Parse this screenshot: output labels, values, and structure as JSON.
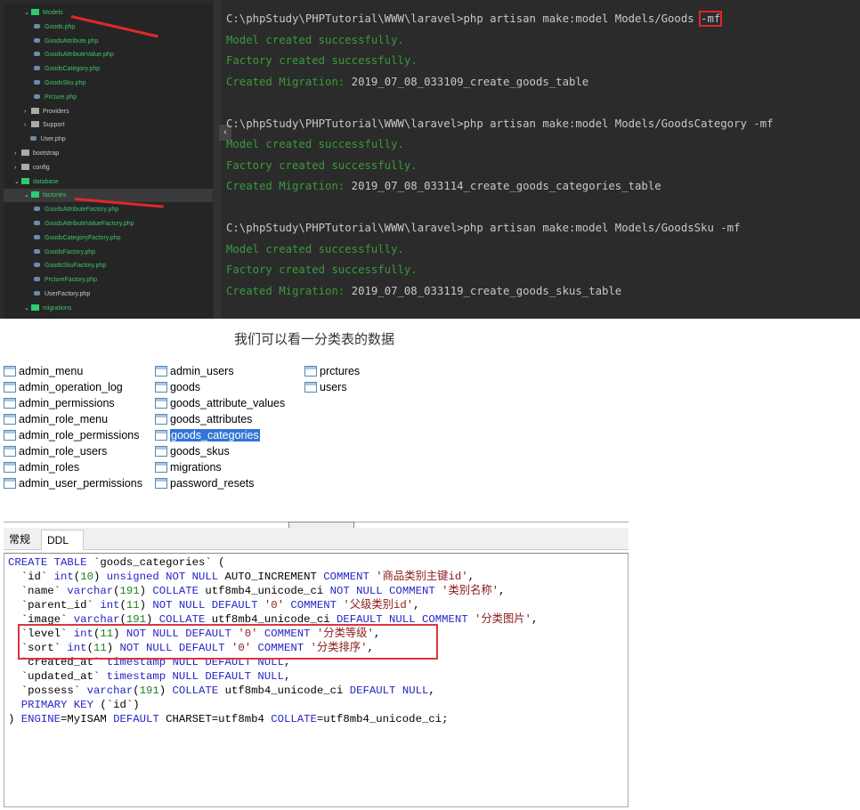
{
  "tree": [
    {
      "label": "Models",
      "kind": "folder",
      "open": true,
      "indent": 1,
      "green": true
    },
    {
      "label": "Goods.php",
      "kind": "php",
      "indent": 2,
      "green": true
    },
    {
      "label": "GoodsAttribute.php",
      "kind": "php",
      "indent": 2,
      "green": true
    },
    {
      "label": "GoodsAttributeValue.php",
      "kind": "php",
      "indent": 2,
      "green": true
    },
    {
      "label": "GoodsCategory.php",
      "kind": "php",
      "indent": 2,
      "green": true
    },
    {
      "label": "GoodsSku.php",
      "kind": "php",
      "indent": 2,
      "green": true
    },
    {
      "label": "Prcture.php",
      "kind": "php",
      "indent": 2,
      "green": true
    },
    {
      "label": "Providers",
      "kind": "folder",
      "open": false,
      "indent": 1
    },
    {
      "label": "Support",
      "kind": "folder",
      "open": false,
      "indent": 1
    },
    {
      "label": "User.php",
      "kind": "php",
      "indent": 1.6
    },
    {
      "label": "bootstrap",
      "kind": "folder",
      "open": false,
      "indent": 0
    },
    {
      "label": "config",
      "kind": "folder",
      "open": false,
      "indent": 0
    },
    {
      "label": "database",
      "kind": "folder",
      "open": true,
      "indent": 0,
      "green": true
    },
    {
      "label": "factories",
      "kind": "folder",
      "open": true,
      "indent": 1,
      "green": true,
      "selected": true
    },
    {
      "label": "GoodsAttributeFactory.php",
      "kind": "php",
      "indent": 2,
      "green": true
    },
    {
      "label": "GoodsAttributeValueFactory.php",
      "kind": "php",
      "indent": 2,
      "green": true
    },
    {
      "label": "GoodsCategoryFactory.php",
      "kind": "php",
      "indent": 2,
      "green": true
    },
    {
      "label": "GoodsFactory.php",
      "kind": "php",
      "indent": 2,
      "green": true
    },
    {
      "label": "GoodsSkuFactory.php",
      "kind": "php",
      "indent": 2,
      "green": true
    },
    {
      "label": "PrctureFactory.php",
      "kind": "php",
      "indent": 2,
      "green": true
    },
    {
      "label": "UserFactory.php",
      "kind": "php",
      "indent": 2
    },
    {
      "label": "migrations",
      "kind": "folder",
      "open": true,
      "indent": 1,
      "green": true
    }
  ],
  "terminal": [
    {
      "type": "cmd",
      "text": "C:\\phpStudy\\PHPTutorial\\WWW\\laravel>php artisan make:model Models/Goods ",
      "flag": "-mf",
      "highlight": true
    },
    {
      "type": "ok",
      "text": "Model created successfully."
    },
    {
      "type": "ok",
      "text": "Factory created successfully."
    },
    {
      "type": "mig",
      "text": "Created Migration: ",
      "name": "2019_07_08_033109_create_goods_table"
    },
    {
      "type": "blank",
      "text": ""
    },
    {
      "type": "cmd",
      "text": "C:\\phpStudy\\PHPTutorial\\WWW\\laravel>php artisan make:model Models/GoodsCategory ",
      "flag": "-mf"
    },
    {
      "type": "ok",
      "text": "Model created successfully."
    },
    {
      "type": "ok",
      "text": "Factory created successfully."
    },
    {
      "type": "mig",
      "text": "Created Migration: ",
      "name": "2019_07_08_033114_create_goods_categories_table"
    },
    {
      "type": "blank",
      "text": ""
    },
    {
      "type": "cmd",
      "text": "C:\\phpStudy\\PHPTutorial\\WWW\\laravel>php artisan make:model Models/GoodsSku ",
      "flag": "-mf"
    },
    {
      "type": "ok",
      "text": "Model created successfully."
    },
    {
      "type": "ok",
      "text": "Factory created successfully."
    },
    {
      "type": "mig",
      "text": "Created Migration: ",
      "name": "2019_07_08_033119_create_goods_skus_table"
    }
  ],
  "caption": "我们可以看一分类表的数据",
  "tables": [
    [
      "admin_menu",
      "admin_operation_log",
      "admin_permissions",
      "admin_role_menu",
      "admin_role_permissions",
      "admin_role_users",
      "admin_roles",
      "admin_user_permissions"
    ],
    [
      "admin_users",
      "goods",
      "goods_attribute_values",
      "goods_attributes",
      "goods_categories",
      "goods_skus",
      "migrations",
      "password_resets"
    ],
    [
      "prctures",
      "users"
    ]
  ],
  "selected_table": "goods_categories",
  "tabs": [
    {
      "label": "常规",
      "active": false
    },
    {
      "label": "DDL",
      "active": true
    }
  ],
  "ddl": [
    [
      [
        "kw",
        "CREATE TABLE "
      ],
      [
        "pl",
        "`goods_categories` ("
      ]
    ],
    [
      [
        "pl",
        "  `id` "
      ],
      [
        "kw",
        "int"
      ],
      [
        "pl",
        "("
      ],
      [
        "num",
        "10"
      ],
      [
        "pl",
        ") "
      ],
      [
        "kw",
        "unsigned NOT NULL "
      ],
      [
        "pl",
        "AUTO_INCREMENT "
      ],
      [
        "kw",
        "COMMENT "
      ],
      [
        "str",
        "'商品类别主键id'"
      ],
      [
        "pl",
        ","
      ]
    ],
    [
      [
        "pl",
        "  `name` "
      ],
      [
        "kw",
        "varchar"
      ],
      [
        "pl",
        "("
      ],
      [
        "num",
        "191"
      ],
      [
        "pl",
        ") "
      ],
      [
        "kw",
        "COLLATE "
      ],
      [
        "pl",
        "utf8mb4_unicode_ci "
      ],
      [
        "kw",
        "NOT NULL COMMENT "
      ],
      [
        "str",
        "'类别名称'"
      ],
      [
        "pl",
        ","
      ]
    ],
    [
      [
        "pl",
        "  `parent_id` "
      ],
      [
        "kw",
        "int"
      ],
      [
        "pl",
        "("
      ],
      [
        "num",
        "11"
      ],
      [
        "pl",
        ") "
      ],
      [
        "kw",
        "NOT NULL DEFAULT "
      ],
      [
        "str",
        "'0' "
      ],
      [
        "kw",
        "COMMENT "
      ],
      [
        "str",
        "'父级类别id'"
      ],
      [
        "pl",
        ","
      ]
    ],
    [
      [
        "pl",
        "  `image` "
      ],
      [
        "kw",
        "varchar"
      ],
      [
        "pl",
        "("
      ],
      [
        "num",
        "191"
      ],
      [
        "pl",
        ") "
      ],
      [
        "kw",
        "COLLATE "
      ],
      [
        "pl",
        "utf8mb4_unicode_ci "
      ],
      [
        "kw",
        "DEFAULT NULL COMMENT "
      ],
      [
        "str",
        "'分类图片'"
      ],
      [
        "pl",
        ","
      ]
    ],
    [
      [
        "pl",
        "  `level` "
      ],
      [
        "kw",
        "int"
      ],
      [
        "pl",
        "("
      ],
      [
        "num",
        "11"
      ],
      [
        "pl",
        ") "
      ],
      [
        "kw",
        "NOT NULL DEFAULT "
      ],
      [
        "str",
        "'0' "
      ],
      [
        "kw",
        "COMMENT "
      ],
      [
        "str",
        "'分类等级'"
      ],
      [
        "pl",
        ","
      ]
    ],
    [
      [
        "pl",
        "  `sort` "
      ],
      [
        "kw",
        "int"
      ],
      [
        "pl",
        "("
      ],
      [
        "num",
        "11"
      ],
      [
        "pl",
        ") "
      ],
      [
        "kw",
        "NOT NULL DEFAULT "
      ],
      [
        "str",
        "'0' "
      ],
      [
        "kw",
        "COMMENT "
      ],
      [
        "str",
        "'分类排序'"
      ],
      [
        "pl",
        ","
      ]
    ],
    [
      [
        "pl",
        "  `created_at` "
      ],
      [
        "kw",
        "timestamp NULL DEFAULT NULL"
      ],
      [
        "pl",
        ","
      ]
    ],
    [
      [
        "pl",
        "  `updated_at` "
      ],
      [
        "kw",
        "timestamp NULL DEFAULT NULL"
      ],
      [
        "pl",
        ","
      ]
    ],
    [
      [
        "pl",
        "  `possess` "
      ],
      [
        "kw",
        "varchar"
      ],
      [
        "pl",
        "("
      ],
      [
        "num",
        "191"
      ],
      [
        "pl",
        ") "
      ],
      [
        "kw",
        "COLLATE "
      ],
      [
        "pl",
        "utf8mb4_unicode_ci "
      ],
      [
        "kw",
        "DEFAULT NULL"
      ],
      [
        "pl",
        ","
      ]
    ],
    [
      [
        "kw",
        "  PRIMARY KEY "
      ],
      [
        "pl",
        "(`id`)"
      ]
    ],
    [
      [
        "pl",
        ") "
      ],
      [
        "kw",
        "ENGINE"
      ],
      [
        "pl",
        "=MyISAM "
      ],
      [
        "kw",
        "DEFAULT "
      ],
      [
        "pl",
        "CHARSET=utf8mb4 "
      ],
      [
        "kw",
        "COLLATE"
      ],
      [
        "pl",
        "=utf8mb4_unicode_ci;"
      ]
    ]
  ],
  "colors": {
    "terminal_bg": "#2b2b2b",
    "tree_bg": "#252526",
    "success_green": "#3a9a3a",
    "highlight_red": "#e0262b",
    "selection_blue": "#3375d6"
  }
}
